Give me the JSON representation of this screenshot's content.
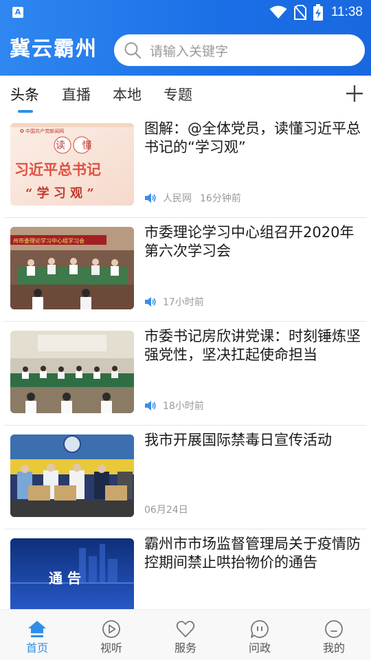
{
  "status_bar": {
    "time": "11:38",
    "left_icon": "A",
    "icons": [
      "wifi-icon",
      "no-sim-icon",
      "battery-charging-icon"
    ]
  },
  "app_bar": {
    "title": "冀云霸州",
    "search_placeholder": "请输入关键字"
  },
  "tabs": [
    {
      "label": "头条",
      "active": true
    },
    {
      "label": "直播",
      "active": false
    },
    {
      "label": "本地",
      "active": false
    },
    {
      "label": "专题",
      "active": false
    }
  ],
  "add_channel_icon": "plus-icon",
  "news": [
    {
      "title": "图解：@全体党员，读懂习近平总书记的“学习观”",
      "source": "人民网",
      "time": "16分钟前",
      "thumb_text": {
        "top": "读 懂",
        "middle": "习近平总书记",
        "bottom": "“ 学 习 观 ”"
      }
    },
    {
      "title": "市委理论学习中心组召开2020年第六次学习会",
      "source": "",
      "time": "17小时前"
    },
    {
      "title": "市委书记房欣讲党课：时刻锤炼坚强党性，坚决扛起使命担当",
      "source": "",
      "time": "18小时前"
    },
    {
      "title": "我市开展国际禁毒日宣传活动",
      "source": "",
      "time": "06月24日"
    },
    {
      "title": "霸州市市场监督管理局关于疫情防控期间禁止哄抬物价的通告",
      "source": "",
      "time": "",
      "thumb_text": {
        "middle": "通 告"
      }
    }
  ],
  "bottom_nav": [
    {
      "label": "首页",
      "icon": "home-icon",
      "active": true
    },
    {
      "label": "视听",
      "icon": "play-icon",
      "active": false
    },
    {
      "label": "服务",
      "icon": "heart-icon",
      "active": false
    },
    {
      "label": "问政",
      "icon": "chat-icon",
      "active": false
    },
    {
      "label": "我的",
      "icon": "profile-icon",
      "active": false
    }
  ],
  "colors": {
    "header_blue": "#2f87f0",
    "accent": "#2f8fe8",
    "meta_gray": "#9a9a9a"
  }
}
